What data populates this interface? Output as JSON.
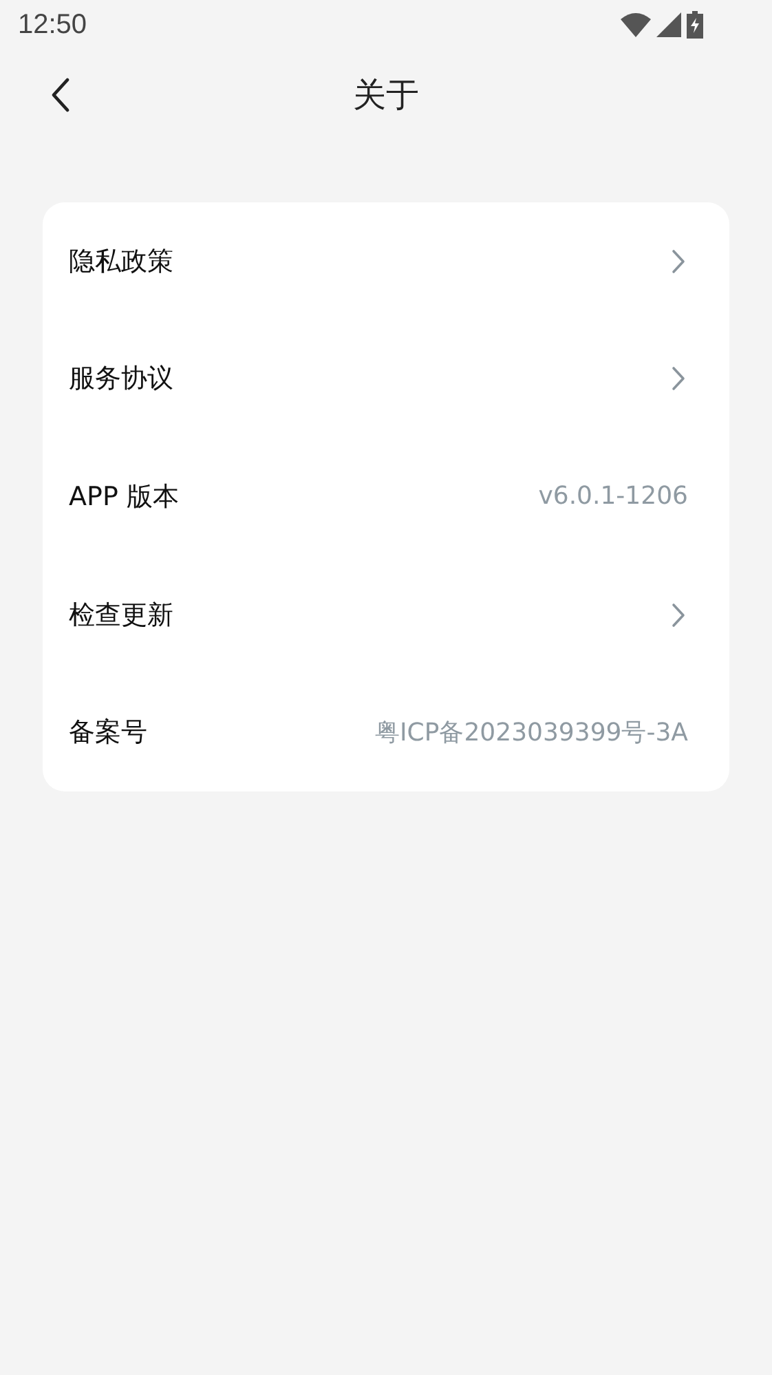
{
  "status_bar": {
    "time": "12:50"
  },
  "header": {
    "title": "关于"
  },
  "rows": [
    {
      "kind": "link",
      "label": "隐私政策"
    },
    {
      "kind": "link",
      "label": "服务协议"
    },
    {
      "kind": "value",
      "label": "APP 版本",
      "value": "v6.0.1-1206"
    },
    {
      "kind": "link",
      "label": "检查更新"
    },
    {
      "kind": "value",
      "label": "备案号",
      "value": "粤ICP备2023039399号-3A"
    }
  ]
}
